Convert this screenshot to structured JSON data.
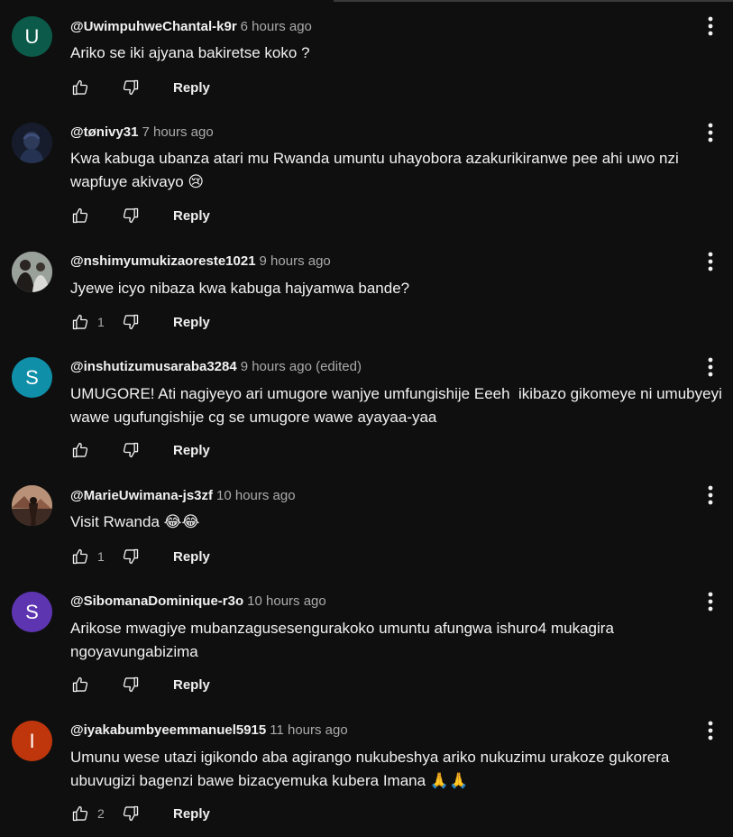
{
  "comments": [
    {
      "author": "@UwimpuhweChantal-k9r",
      "time": "6 hours ago",
      "text": "Ariko se iki ajyana bakiretse koko ?",
      "likes": "",
      "reply_label": "Reply",
      "avatar_letter": "U",
      "avatar_color": "#0b5a4a"
    },
    {
      "author": "@tønivy31",
      "time": "7 hours ago",
      "text": "Kwa kabuga ubanza atari mu Rwanda umuntu uhayobora azakurikiranwe pee ahi uwo nzi wapfuye akivayo 😢",
      "likes": "",
      "reply_label": "Reply",
      "avatar_letter": "",
      "avatar_color": "#1b2236"
    },
    {
      "author": "@nshimyumukizaoreste1021",
      "time": "9 hours ago",
      "text": "Jyewe icyo nibaza kwa kabuga hajyamwa bande?",
      "likes": "1",
      "reply_label": "Reply",
      "avatar_letter": "",
      "avatar_color": "#8a8f8a"
    },
    {
      "author": "@inshutizumusaraba3284",
      "time": "9 hours ago (edited)",
      "text": "UMUGORE! Ati nagiyeyo ari umugore wanjye umfungishije Eeeh  ikibazo gikomeye ni umubyeyi wawe ugufungishije cg se umugore wawe ayayaa-yaa",
      "likes": "",
      "reply_label": "Reply",
      "avatar_letter": "S",
      "avatar_color": "#0f8fa8"
    },
    {
      "author": "@MarieUwimana-js3zf",
      "time": "10 hours ago",
      "text": "Visit Rwanda 😂😂",
      "likes": "1",
      "reply_label": "Reply",
      "avatar_letter": "",
      "avatar_color": "#6b4a3a"
    },
    {
      "author": "@SibomanaDominique-r3o",
      "time": "10 hours ago",
      "text": "Arikose mwagiye mubanzagusesengurakoko umuntu afungwa ishuro4 mukagira ngoyavungabizima",
      "likes": "",
      "reply_label": "Reply",
      "avatar_letter": "S",
      "avatar_color": "#5e35b1"
    },
    {
      "author": "@iyakabumbyeemmanuel5915",
      "time": "11 hours ago",
      "text": "Umunu wese utazi igikondo aba agirango nukubeshya ariko nukuzimu urakoze gukorera ubuvugizi bagenzi bawe bizacyemuka kubera Imana 🙏🙏",
      "likes": "2",
      "reply_label": "Reply",
      "avatar_letter": "I",
      "avatar_color": "#bf360c"
    }
  ],
  "icons": {
    "like": "thumbs-up-icon",
    "dislike": "thumbs-down-icon",
    "menu": "more-vert-icon"
  }
}
